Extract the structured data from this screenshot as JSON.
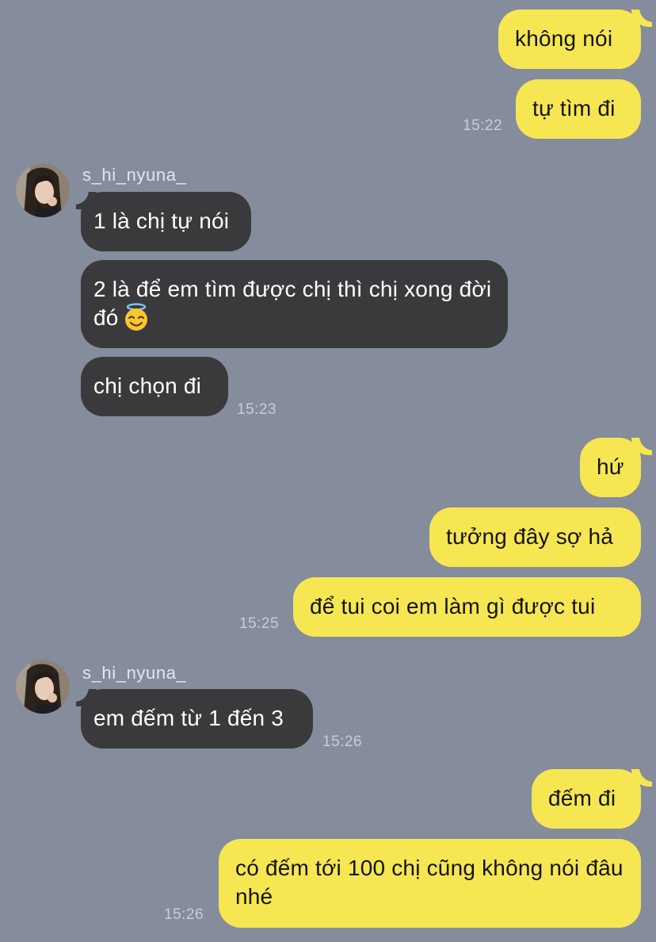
{
  "chat": {
    "contact_username": "s_hi_nyuna_",
    "avatar_icon": "profile-photo",
    "colors": {
      "background": "#858c9c",
      "outgoing_bubble": "#f6e652",
      "incoming_bubble": "#3a3a3c",
      "timestamp": "#c9cdd6"
    },
    "messages": [
      {
        "direction": "out",
        "text": "không nói"
      },
      {
        "direction": "out",
        "text": "tự tìm đi",
        "time": "15:22"
      },
      {
        "direction": "in",
        "sender": "s_hi_nyuna_",
        "text": "1 là chị tự nói"
      },
      {
        "direction": "in",
        "text": "2 là để em tìm được chị thì chị xong đời đó",
        "emoji": "smiling-face-with-halo"
      },
      {
        "direction": "in",
        "text": "chị chọn đi",
        "time": "15:23"
      },
      {
        "direction": "out",
        "text": "hứ"
      },
      {
        "direction": "out",
        "text": "tưởng đây sợ hả"
      },
      {
        "direction": "out",
        "text": "để tui coi em làm gì được tui",
        "time": "15:25"
      },
      {
        "direction": "in",
        "sender": "s_hi_nyuna_",
        "text": "em đếm từ 1 đến 3",
        "time": "15:26"
      },
      {
        "direction": "out",
        "text": "đếm đi"
      },
      {
        "direction": "out",
        "text": "có đếm tới 100 chị cũng không nói đâu nhé",
        "time": "15:26"
      }
    ]
  }
}
